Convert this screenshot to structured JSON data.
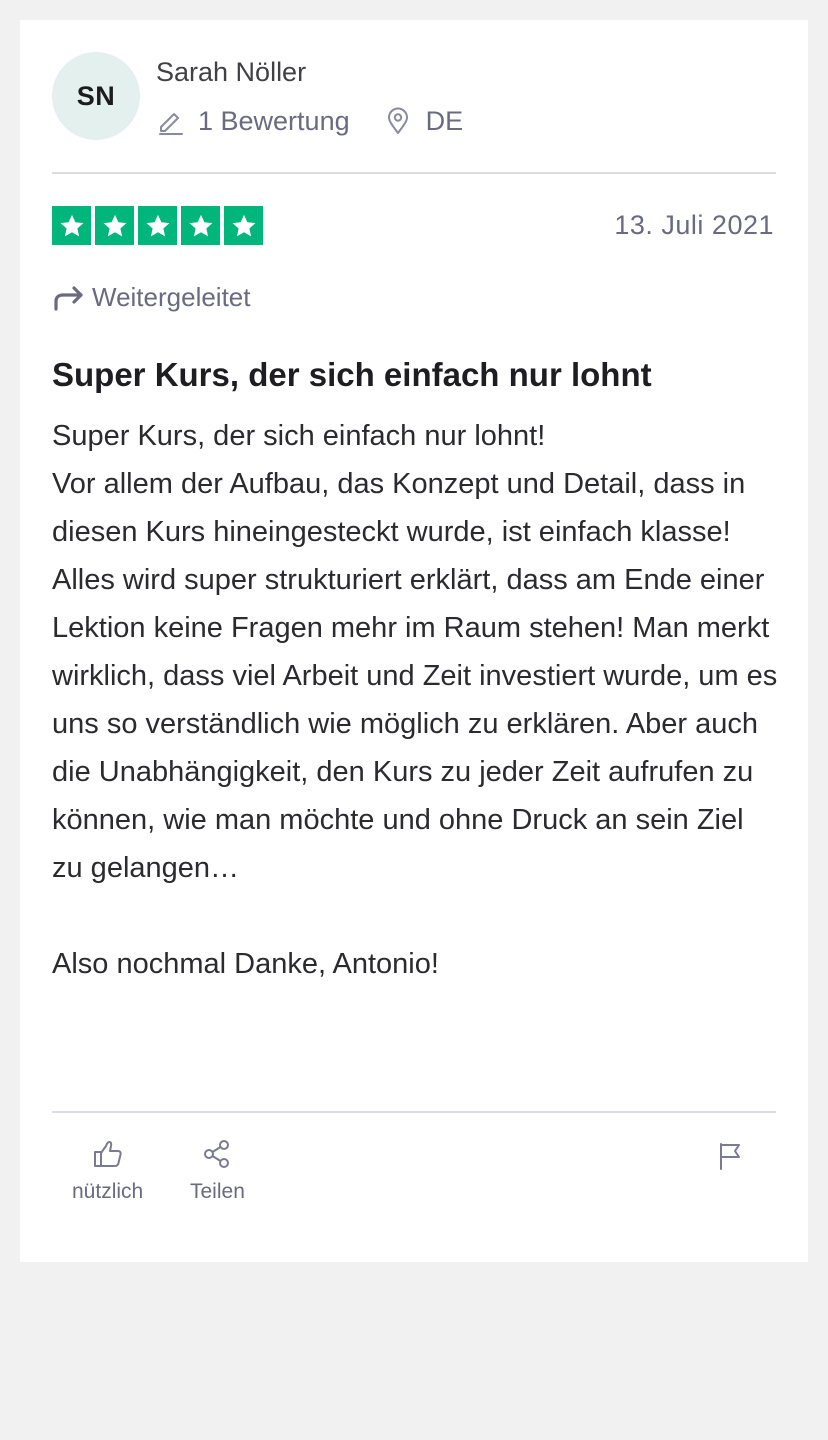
{
  "reviewer": {
    "initials": "SN",
    "name": "Sarah Nöller",
    "reviews_count": "1 Bewertung",
    "country": "DE"
  },
  "review": {
    "rating": 5,
    "date": "13. Juli 2021",
    "forwarded_label": "Weitergeleitet",
    "title": "Super Kurs, der sich einfach nur lohnt",
    "body": "Super Kurs, der sich einfach nur lohnt!\nVor allem der Aufbau, das Konzept und Detail, dass in diesen Kurs hineingesteckt wurde, ist einfach klasse!\nAlles wird super strukturiert erklärt, dass am Ende einer Lektion keine Fragen mehr im Raum stehen! Man merkt wirklich, dass viel Arbeit und Zeit investiert wurde, um es uns so verständlich wie möglich zu erklären. Aber auch die Unabhängigkeit, den Kurs zu jeder Zeit aufrufen zu können, wie man möchte und ohne Druck an sein Ziel zu gelangen…\n\nAlso nochmal Danke, Antonio!"
  },
  "actions": {
    "useful_label": "nützlich",
    "share_label": "Teilen"
  },
  "icons": {
    "reviews": "pencil-icon",
    "location": "location-pin-icon",
    "star": "star-icon",
    "forwarded": "forward-arrow-icon",
    "useful": "thumbs-up-icon",
    "share": "share-icon",
    "report": "flag-icon"
  },
  "colors": {
    "star_background": "#00b67a",
    "avatar_background": "#e3f0ee",
    "secondary_text": "#6a6a80",
    "page_background": "#f1f1f2"
  }
}
